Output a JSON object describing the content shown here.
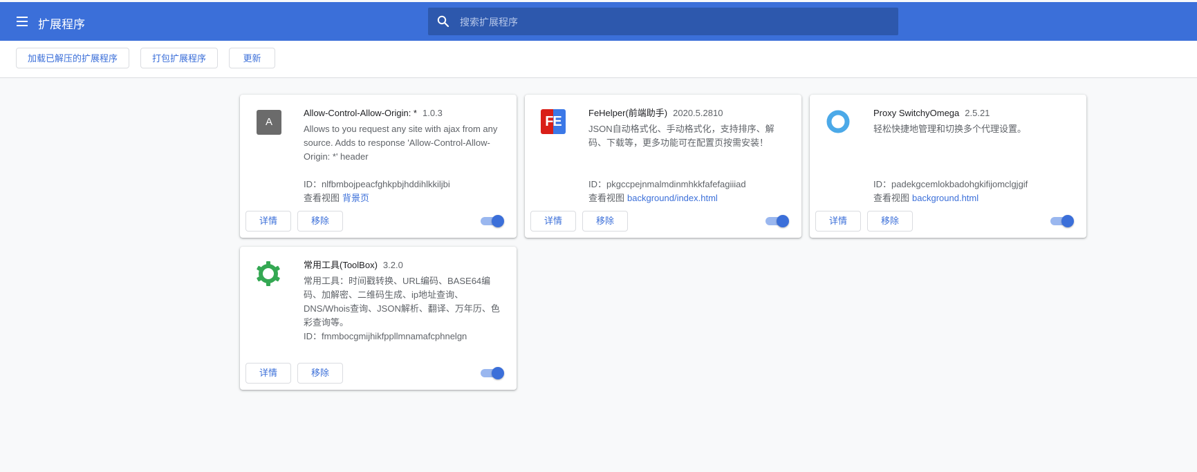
{
  "header": {
    "title": "扩展程序",
    "search_placeholder": "搜索扩展程序"
  },
  "toolbar": {
    "load_unpacked": "加载已解压的扩展程序",
    "pack": "打包扩展程序",
    "update": "更新"
  },
  "common": {
    "details": "详情",
    "remove": "移除",
    "id_prefix": "ID：",
    "views_prefix": "查看视图"
  },
  "extensions": [
    {
      "name": "Allow-Control-Allow-Origin: *",
      "version": "1.0.3",
      "description": "Allows to you request any site with ajax from any source. Adds to response 'Allow-Control-Allow-Origin: *' header",
      "id": "nlfbmbojpeacfghkpbjhddihlkkiljbi",
      "view_link": "背景页",
      "enabled": true,
      "icon": "letter-a-icon",
      "icon_letter": "A"
    },
    {
      "name": "FeHelper(前端助手)",
      "version": "2020.5.2810",
      "description": "JSON自动格式化、手动格式化，支持排序、解码、下载等，更多功能可在配置页按需安装！",
      "id": "pkgccpejnmalmdinmhkkfafefagiiiad",
      "view_link": "background/index.html",
      "enabled": true,
      "icon": "fehelper-icon",
      "icon_letter": "FE"
    },
    {
      "name": "Proxy SwitchyOmega",
      "version": "2.5.21",
      "description": "轻松快捷地管理和切换多个代理设置。",
      "id": "padekgcemlokbadohgkifijomclgjgif",
      "view_link": "background.html",
      "enabled": true,
      "icon": "switchyomega-ring-icon"
    },
    {
      "name": "常用工具(ToolBox)",
      "version": "3.2.0",
      "description": "常用工具：时间戳转换、URL编码、BASE64编码、加解密、二维码生成、ip地址查询、DNS/Whois查询、JSON解析、翻译、万年历、色彩查询等。",
      "id": "fmmbocgmijhikfppllmnamafcphnelgn",
      "enabled": true,
      "icon": "toolbox-gear-icon"
    }
  ],
  "colors": {
    "header": "#3b6fd9",
    "search": "#2d58ad",
    "accent": "#3b6fd9",
    "gear": "#34a853",
    "ring": "#4ba9e8",
    "fe_red": "#d91e18"
  }
}
